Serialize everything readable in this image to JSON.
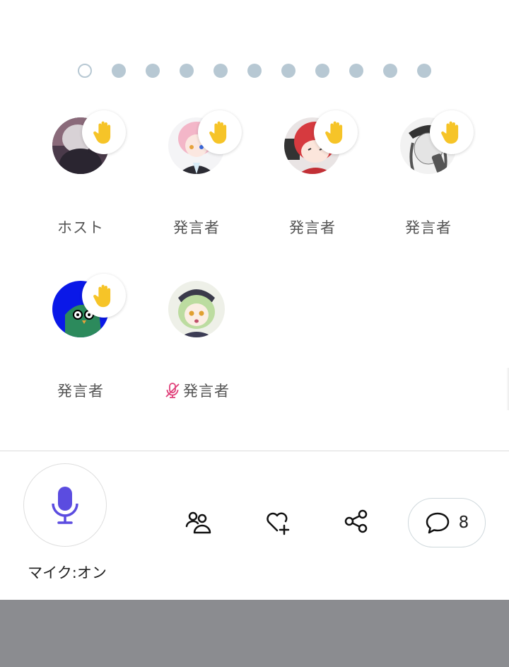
{
  "pager": {
    "count": 11,
    "active_index": 0
  },
  "speakers": [
    {
      "label": "ホスト",
      "raised_hand": true,
      "muted": false,
      "avatar": "avatar-gray-hair"
    },
    {
      "label": "発言者",
      "raised_hand": true,
      "muted": false,
      "avatar": "avatar-pink-hair"
    },
    {
      "label": "発言者",
      "raised_hand": true,
      "muted": false,
      "avatar": "avatar-red-hair"
    },
    {
      "label": "発言者",
      "raised_hand": true,
      "muted": false,
      "avatar": "avatar-monochrome-cap"
    },
    {
      "label": "発言者",
      "raised_hand": true,
      "muted": false,
      "avatar": "avatar-green-creature"
    },
    {
      "label": "発言者",
      "raised_hand": false,
      "muted": true,
      "avatar": "avatar-green-hair"
    }
  ],
  "controls": {
    "mic_label": "マイク:オン",
    "comment_count": "8"
  },
  "colors": {
    "mic_accent": "#5b4ce0",
    "mute_accent": "#e0407a",
    "hand": "#f6c428",
    "dot": "#b7c8d3",
    "bottom_bar": "#8b8c90"
  }
}
